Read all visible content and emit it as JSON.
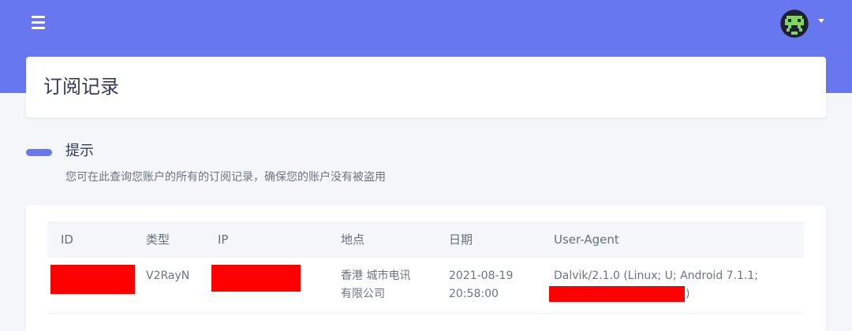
{
  "header": {
    "menu_icon": "hamburger-menu-icon",
    "avatar_icon": "pixel-avatar-icon",
    "dropdown_icon": "caret-down-icon",
    "accent_color": "#6777ef"
  },
  "page": {
    "title": "订阅记录"
  },
  "tip": {
    "title": "提示",
    "description": "您可在此查询您账户的所有的订阅记录，确保您的账户没有被盗用"
  },
  "table": {
    "columns": [
      "ID",
      "类型",
      "IP",
      "地点",
      "日期",
      "User-Agent"
    ],
    "rows": [
      {
        "id": "",
        "type": "V2RayN",
        "ip": "",
        "location_line1": "香港 城市电讯",
        "location_line2": "有限公司",
        "date_line1": "2021-08-19",
        "date_line2": "20:58:00",
        "ua_line1": "Dalvik/2.1.0 (Linux; U; Android 7.1.1;",
        "ua_tail": ")",
        "redaction_color": "#ff0000"
      }
    ]
  }
}
